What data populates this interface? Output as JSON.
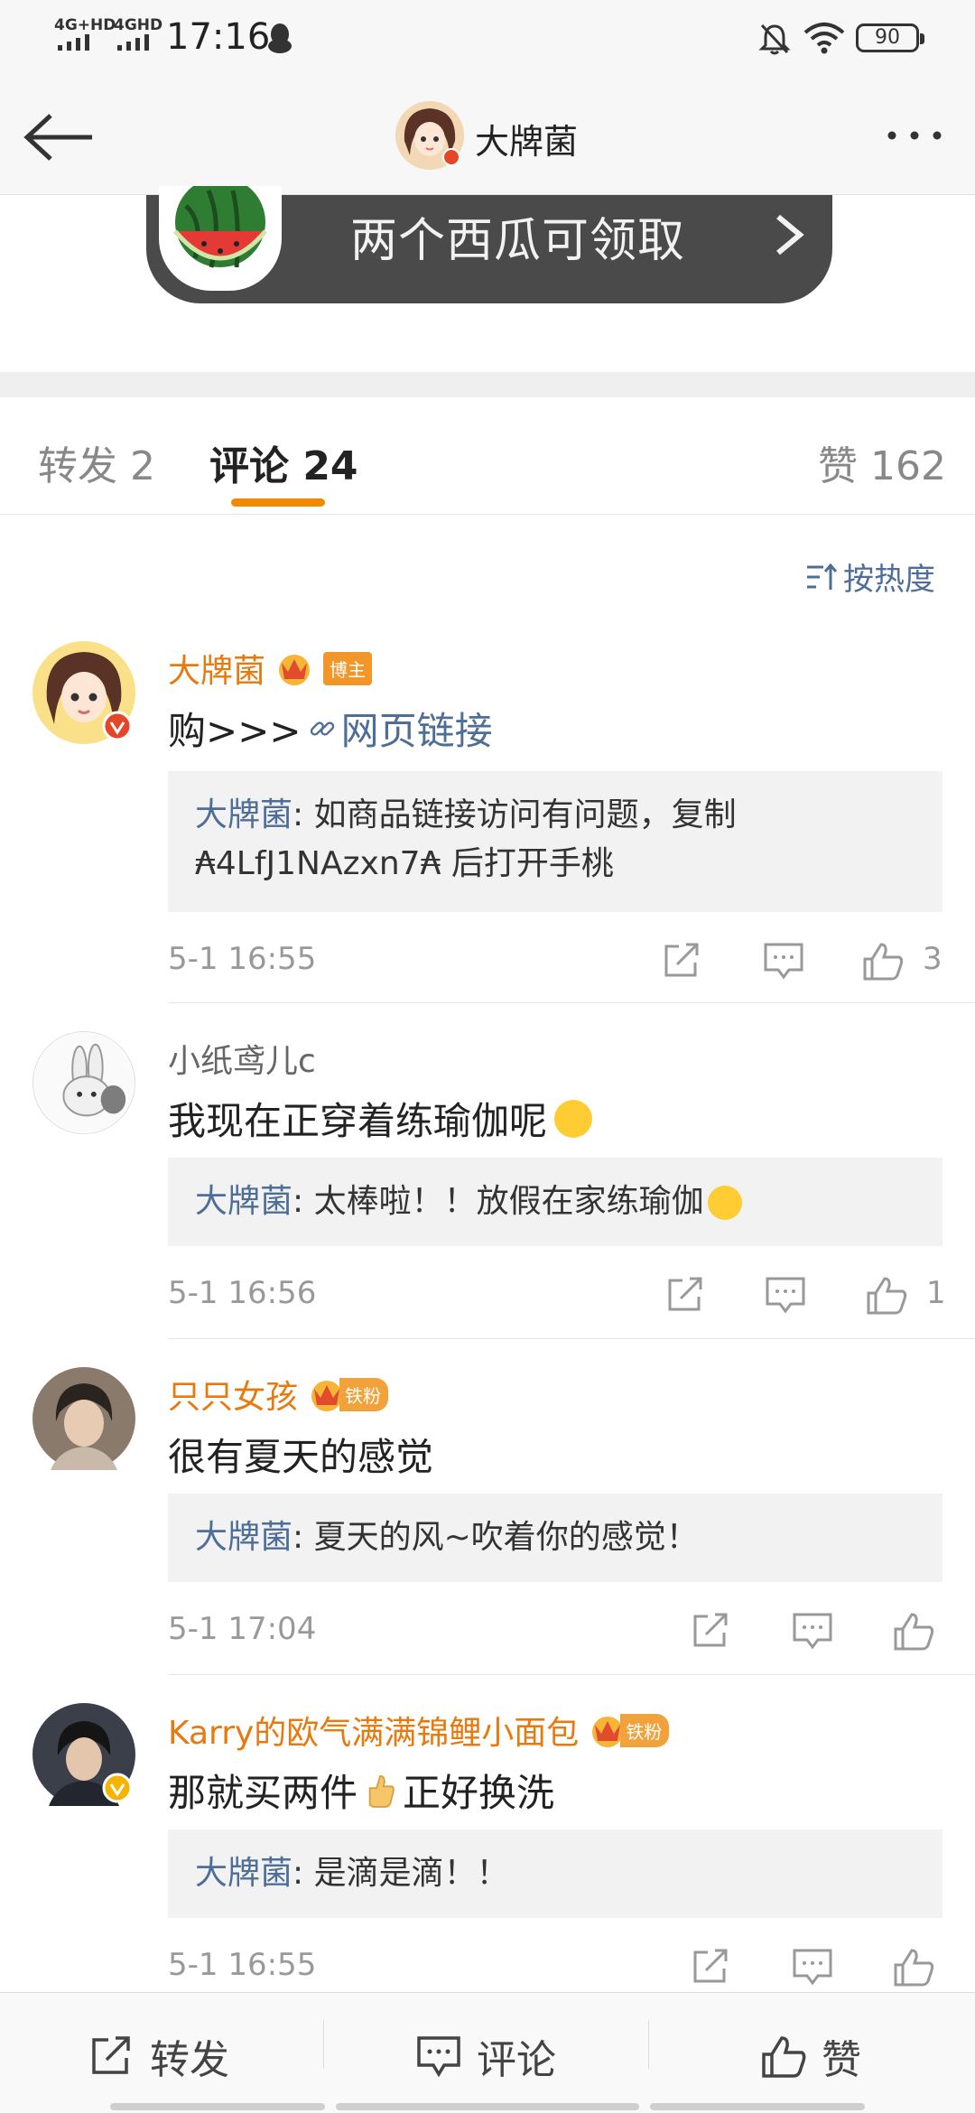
{
  "status_bar": {
    "net1": "4G+HD",
    "net2": "4GHD",
    "time": "17:16",
    "battery": "90",
    "icons": [
      "qq-penguin-icon",
      "bell-muted-icon",
      "wifi-icon",
      "battery-icon"
    ]
  },
  "nav": {
    "title": "大牌菌",
    "back_icon": "back-arrow-icon",
    "more_icon": "more-dots-icon"
  },
  "promo": {
    "text": "两个西瓜可领取",
    "icon": "watermelon-icon"
  },
  "tabs": [
    {
      "label": "转发 2",
      "active": false
    },
    {
      "label": "评论 24",
      "active": true
    },
    {
      "label": "赞 162",
      "active": false
    }
  ],
  "sort": {
    "label": "按热度"
  },
  "comments": [
    {
      "name": "大牌菌",
      "badge": "博主",
      "text": "购>>>",
      "link": "网页链接",
      "reply_name": "大牌菌",
      "reply_text": ": 如商品链接访问有问题，复制 ₳4LfJ1NAzxn7₳ 后打开手桃",
      "time": "5-1 16:55",
      "likes": "3"
    },
    {
      "name": "小纸鸢儿c",
      "text": "我现在正穿着练瑜伽呢",
      "reply_name": "大牌菌",
      "reply_text": ": 太棒啦！！放假在家练瑜伽",
      "time": "5-1 16:56",
      "likes": "1"
    },
    {
      "name": "只只女孩",
      "badge": "铁粉",
      "text": "很有夏天的感觉",
      "reply_name": "大牌菌",
      "reply_text": ": 夏天的风~吹着你的感觉！",
      "time": "5-1 17:04",
      "likes": ""
    },
    {
      "name": "Karry的欧气满满锦鲤小面包",
      "badge": "铁粉",
      "text1": "那就买两件",
      "text2": "正好换洗",
      "reply_name": "大牌菌",
      "reply_text": ": 是滴是滴！！",
      "time": "5-1 16:55",
      "likes": ""
    }
  ],
  "bottom_bar": {
    "repost": "转发",
    "comment": "评论",
    "like": "赞"
  },
  "colors": {
    "accent_orange": "#f08b00",
    "name_orange": "#e8790d",
    "link_blue": "#4e6e98"
  }
}
